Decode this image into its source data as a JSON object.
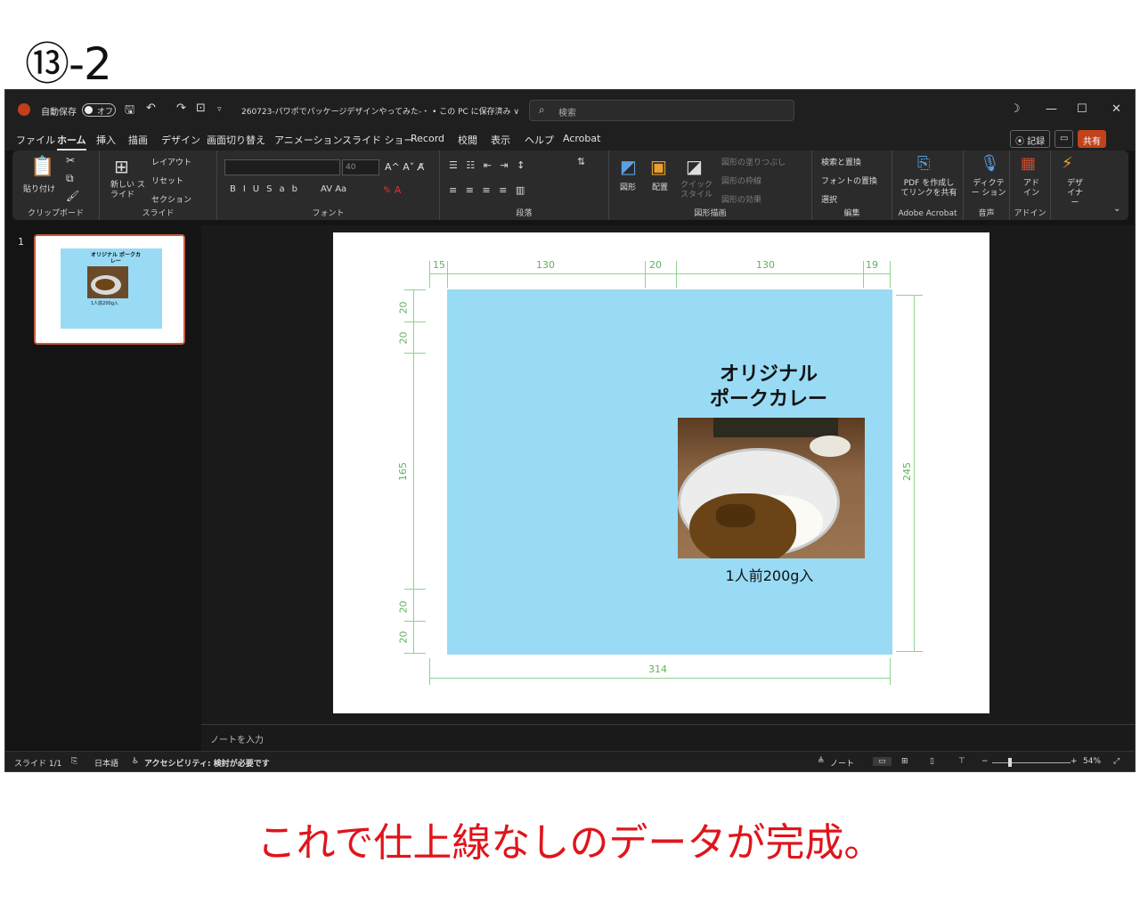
{
  "step_label": "⑬-2",
  "caption": "これで仕上線なしのデータが完成。",
  "titlebar": {
    "autosave_label": "自動保存",
    "autosave_state": "オフ",
    "doc_title": "260723-パワポでパッケージデザインやってみた-・ • この PC に保存済み ∨",
    "search_placeholder": "検索"
  },
  "menu": {
    "tabs": [
      "ファイル",
      "ホーム",
      "挿入",
      "描画",
      "デザイン",
      "画面切り替え",
      "アニメーション",
      "スライド ショー",
      "Record",
      "校閲",
      "表示",
      "ヘルプ",
      "Acrobat"
    ],
    "active_tab": "ホーム",
    "record_label": "⦿ 記録",
    "share_label": "共有"
  },
  "ribbon": {
    "paste": "貼り付け",
    "clipboard": "クリップボード",
    "new_slide": "新しい スライド",
    "layout": "レイアウト",
    "reset": "リセット",
    "section": "セクション",
    "slides": "スライド",
    "font_size": "40",
    "font": "フォント",
    "paragraph": "段落",
    "shape": "図形",
    "arrange": "配置",
    "quick_style": "クイック スタイル",
    "shape_fill": "図形の塗りつぶし",
    "shape_outline": "図形の枠線",
    "shape_effect": "図形の効果",
    "drawing": "図形描画",
    "find_replace": "検索と置換",
    "replace_font": "フォントの置換",
    "select": "選択",
    "editing": "編集",
    "pdf_share": "PDF を作成し てリンクを共有",
    "adobe": "Adobe Acrobat",
    "dictate": "ディクテー ション",
    "voice": "音声",
    "addin": "アド イン",
    "addins": "アドイン",
    "designer": "デザ イナー"
  },
  "thumb": {
    "number": "1",
    "title": "オリジナル ポークカレー",
    "caption": "1人前200g入"
  },
  "slide": {
    "title_line1": "オリジナル",
    "title_line2": "ポークカレー",
    "caption": "1人前200g入",
    "dims": {
      "top_a": "15",
      "top_b": "130",
      "top_c": "20",
      "top_d": "130",
      "top_e": "19",
      "left_a": "20",
      "left_b": "20",
      "left_c": "165",
      "left_d": "20",
      "left_e": "20",
      "right": "245",
      "bottom": "314"
    }
  },
  "notes_placeholder": "ノートを入力",
  "status": {
    "slide": "スライド 1/1",
    "lang": "日本語",
    "accessibility": "アクセシビリティ: 検討が必要です",
    "notes": "ノート",
    "zoom": "54%"
  }
}
